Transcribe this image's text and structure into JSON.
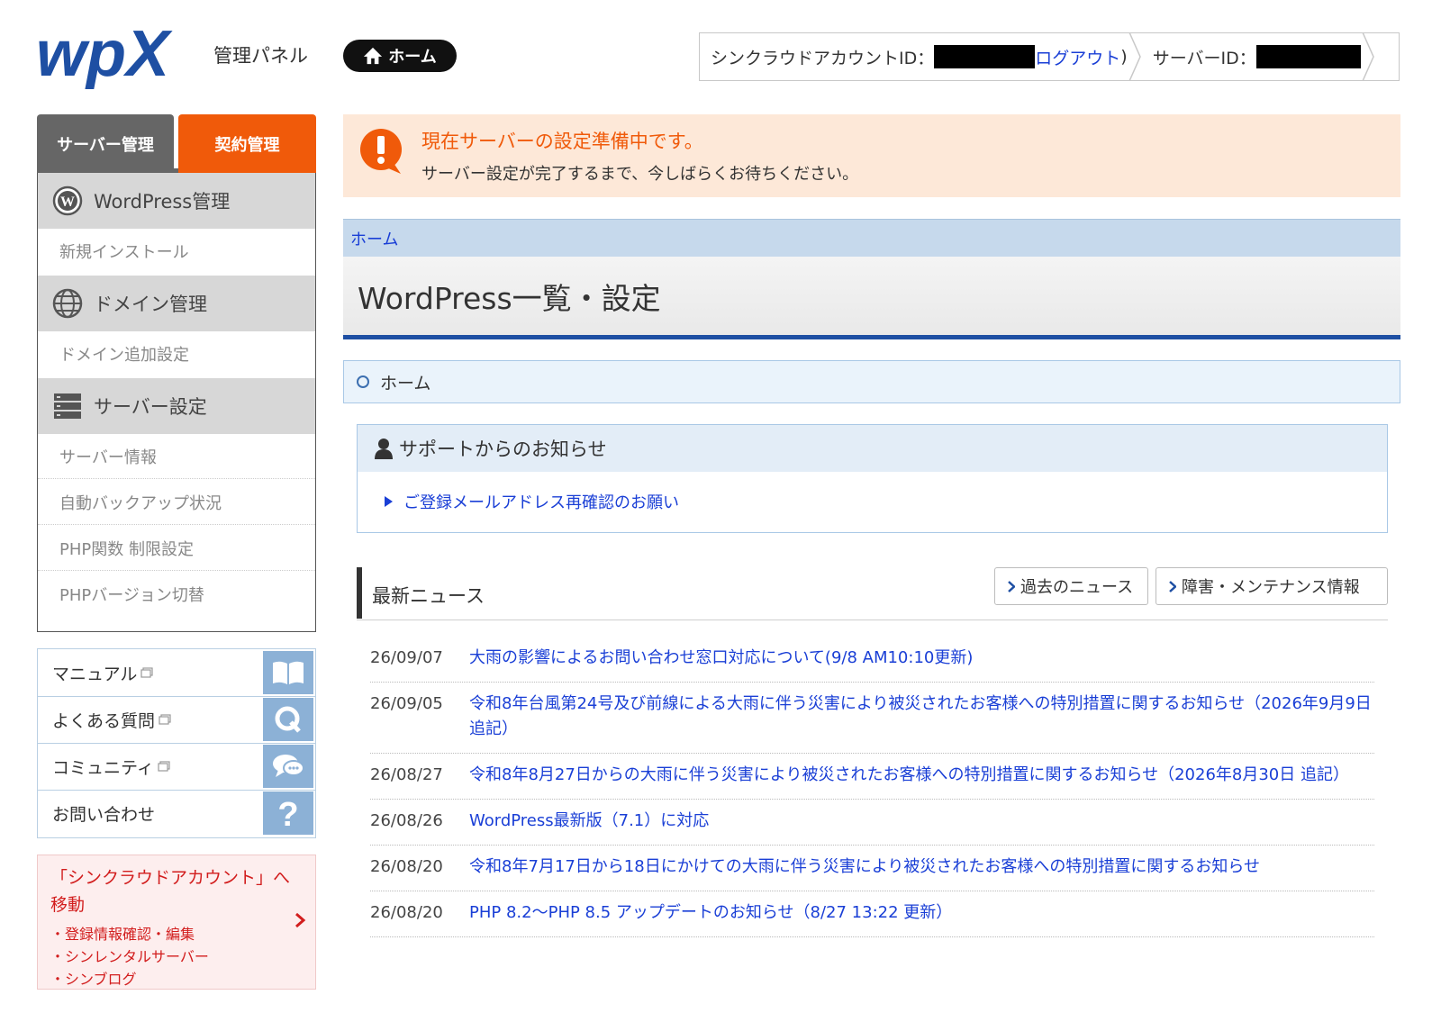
{
  "header": {
    "logo_text": "wpX",
    "panel_title": "管理パネル",
    "home_button": "ホーム",
    "account_label": "シンクラウドアカウントID：",
    "logout": "ログアウト",
    "logout_paren": ")",
    "server_id_label": "サーバーID："
  },
  "sidebar": {
    "tabs": [
      "サーバー管理",
      "契約管理"
    ],
    "sections": [
      {
        "label": "WordPress管理",
        "icon": "wordpress-icon",
        "items": [
          "新規インストール"
        ]
      },
      {
        "label": "ドメイン管理",
        "icon": "globe-icon",
        "items": [
          "ドメイン追加設定"
        ]
      },
      {
        "label": "サーバー設定",
        "icon": "server-icon",
        "items": [
          "サーバー情報",
          "自動バックアップ状況",
          "PHP関数 制限設定",
          "PHPバージョン切替"
        ]
      }
    ],
    "links": [
      {
        "label": "マニュアル",
        "icon": "book-icon"
      },
      {
        "label": "よくある質問",
        "icon": "q-icon"
      },
      {
        "label": "コミュニティ",
        "icon": "chat-icon"
      },
      {
        "label": "お問い合わせ",
        "icon": "question-icon"
      }
    ],
    "sync": {
      "title": "「シンクラウドアカウント」へ移動",
      "items": [
        "・登録情報確認・編集",
        "・シンレンタルサーバー",
        "・シンブログ"
      ]
    }
  },
  "notice": {
    "title": "現在サーバーの設定準備中です。",
    "body": "サーバー設定が完了するまで、今しばらくお待ちください。"
  },
  "breadcrumb": "ホーム",
  "page_title": "WordPress一覧・設定",
  "home_line": "ホーム",
  "support": {
    "title": "サポートからのお知らせ",
    "items": [
      "ご登録メールアドレス再確認のお願い"
    ]
  },
  "news": {
    "title": "最新ニュース",
    "buttons": [
      "過去のニュース",
      "障害・メンテナンス情報"
    ],
    "items": [
      {
        "date": "26/09/07",
        "text": "大雨の影響によるお問い合わせ窓口対応について(9/8 AM10:10更新)"
      },
      {
        "date": "26/09/05",
        "text": "令和8年台風第24号及び前線による大雨に伴う災害により被災されたお客様への特別措置に関するお知らせ（2026年9月9日 追記）"
      },
      {
        "date": "26/08/27",
        "text": "令和8年8月27日からの大雨に伴う災害により被災されたお客様への特別措置に関するお知らせ（2026年8月30日 追記）"
      },
      {
        "date": "26/08/26",
        "text": "WordPress最新版（7.1）に対応"
      },
      {
        "date": "26/08/20",
        "text": "令和8年7月17日から18日にかけての大雨に伴う災害により被災されたお客様への特別措置に関するお知らせ"
      },
      {
        "date": "26/08/20",
        "text": "PHP 8.2～PHP 8.5 アップデートのお知らせ（8/27 13:22 更新）"
      }
    ]
  },
  "colors": {
    "brand_blue": "#1e4fa3",
    "link_blue": "#1a3fd6",
    "accent_orange": "#f05a0a",
    "notice_bg": "#fde8d8",
    "alert_red": "#d21d1d"
  }
}
